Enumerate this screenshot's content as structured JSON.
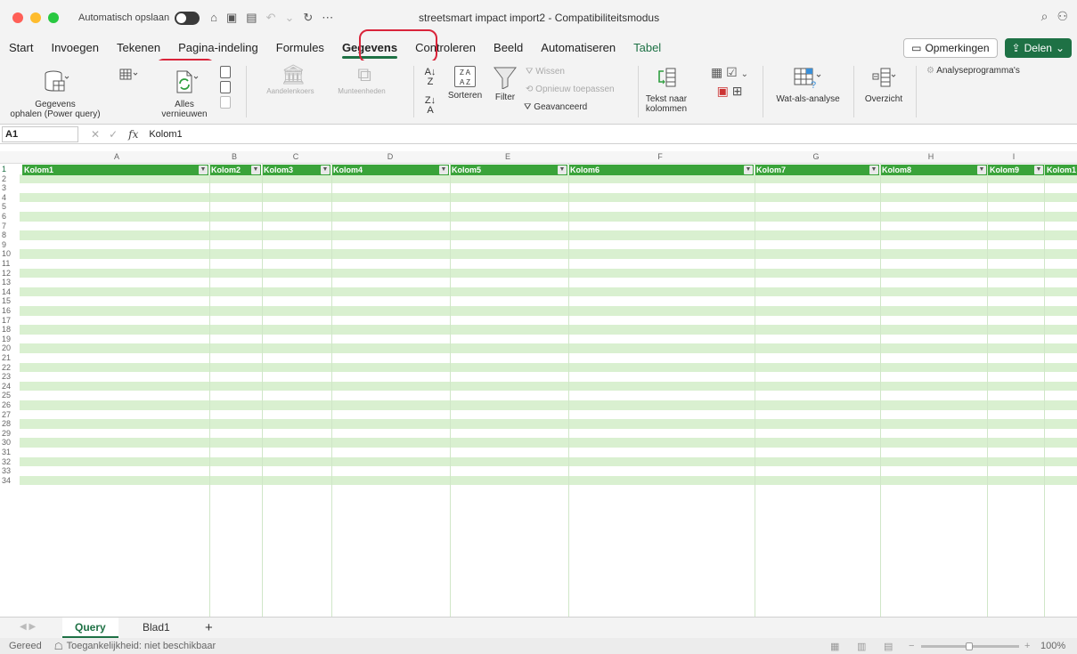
{
  "window": {
    "autosave_label": "Automatisch opslaan",
    "title": "streetsmart impact import2 - Compatibiliteitsmodus"
  },
  "tabs": [
    {
      "label": "Start"
    },
    {
      "label": "Invoegen"
    },
    {
      "label": "Tekenen"
    },
    {
      "label": "Pagina-indeling"
    },
    {
      "label": "Formules"
    },
    {
      "label": "Gegevens"
    },
    {
      "label": "Controleren"
    },
    {
      "label": "Beeld"
    },
    {
      "label": "Automatiseren"
    },
    {
      "label": "Tabel"
    }
  ],
  "header_buttons": {
    "comments": "Opmerkingen",
    "share": "Delen"
  },
  "ribbon": {
    "get_data_line1": "Gegevens",
    "get_data_line2": "ophalen (Power query)",
    "refresh_line1": "Alles",
    "refresh_line2": "vernieuwen",
    "stocks": "Aandelenkoers",
    "currencies": "Munteenheden",
    "sort": "Sorteren",
    "filter": "Filter",
    "clear": "Wissen",
    "reapply": "Opnieuw toepassen",
    "advanced": "Geavanceerd",
    "text_to_columns_line1": "Tekst naar",
    "text_to_columns_line2": "kolommen",
    "what_if": "Wat-als-analyse",
    "outline": "Overzicht",
    "analysis_tools": "Analyseprogramma's"
  },
  "formula_bar": {
    "name_box": "A1",
    "fx_label": "fx",
    "value": "Kolom1"
  },
  "columns": [
    "A",
    "B",
    "C",
    "D",
    "E",
    "F",
    "G",
    "H",
    "I"
  ],
  "table_headers": [
    "Kolom1",
    "Kolom2",
    "Kolom3",
    "Kolom4",
    "Kolom5",
    "Kolom6",
    "Kolom7",
    "Kolom8",
    "Kolom9",
    "Kolom1"
  ],
  "rows": [
    "1",
    "2",
    "3",
    "4",
    "5",
    "6",
    "7",
    "8",
    "9",
    "10",
    "11",
    "12",
    "13",
    "14",
    "15",
    "16",
    "17",
    "18",
    "19",
    "20",
    "21",
    "22",
    "23",
    "24",
    "25",
    "26",
    "27",
    "28",
    "29",
    "30",
    "31",
    "32",
    "33",
    "34"
  ],
  "sheets": {
    "active": "Query",
    "other": "Blad1",
    "add": "+"
  },
  "status": {
    "ready": "Gereed",
    "accessibility": "Toegankelijkheid: niet beschikbaar",
    "zoom": "100%"
  },
  "colors": {
    "accent": "#1e7145",
    "table_header": "#3aa33a",
    "band_row": "#d9f0d0",
    "highlight_ring": "#d9243a"
  }
}
